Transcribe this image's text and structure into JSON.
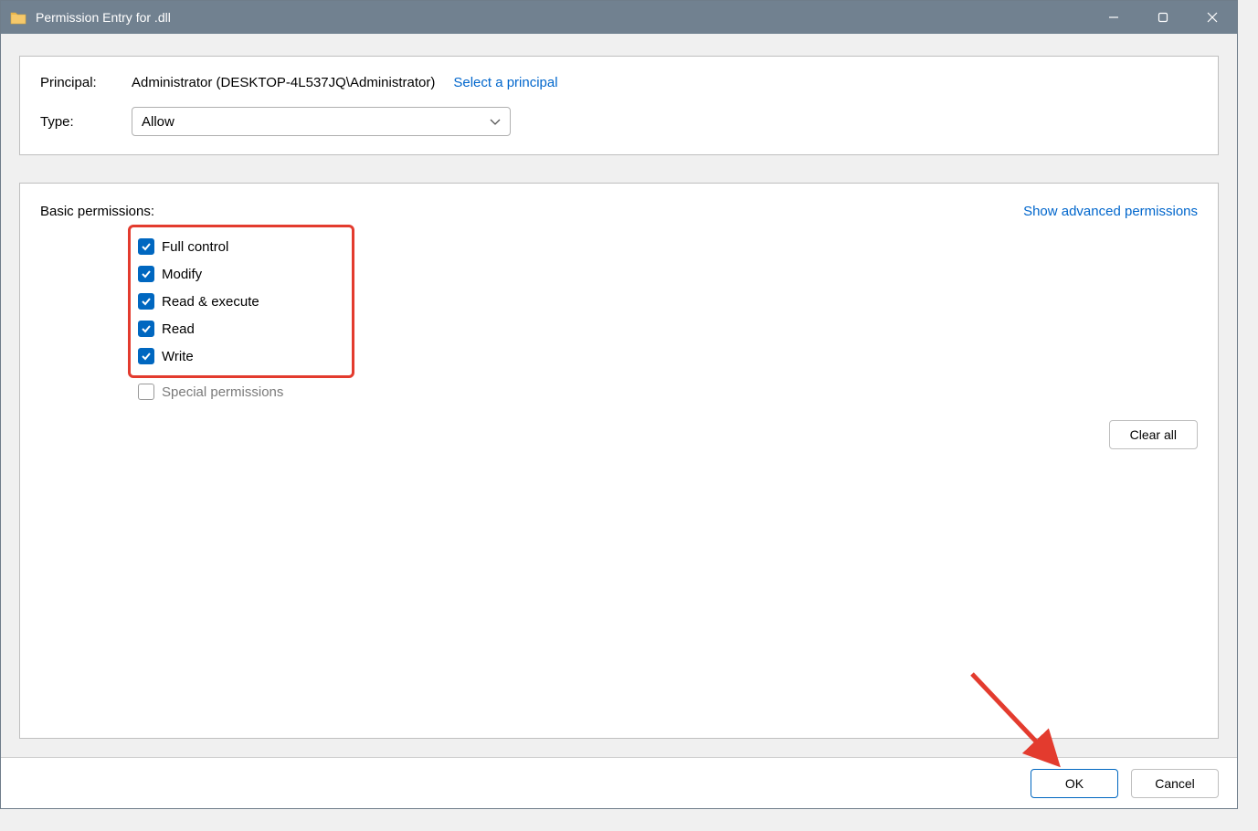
{
  "window": {
    "title": "Permission Entry for         .dll"
  },
  "principal": {
    "label": "Principal:",
    "value": "Administrator (DESKTOP-4L537JQ\\Administrator)",
    "select_link": "Select a principal"
  },
  "type": {
    "label": "Type:",
    "value": "Allow"
  },
  "basic": {
    "title": "Basic permissions:",
    "advanced_link": "Show advanced permissions",
    "perms": [
      {
        "label": "Full control",
        "checked": true
      },
      {
        "label": "Modify",
        "checked": true
      },
      {
        "label": "Read & execute",
        "checked": true
      },
      {
        "label": "Read",
        "checked": true
      },
      {
        "label": "Write",
        "checked": true
      }
    ],
    "special": {
      "label": "Special permissions",
      "checked": false,
      "disabled": true
    },
    "clear_all": "Clear all"
  },
  "footer": {
    "ok": "OK",
    "cancel": "Cancel"
  }
}
